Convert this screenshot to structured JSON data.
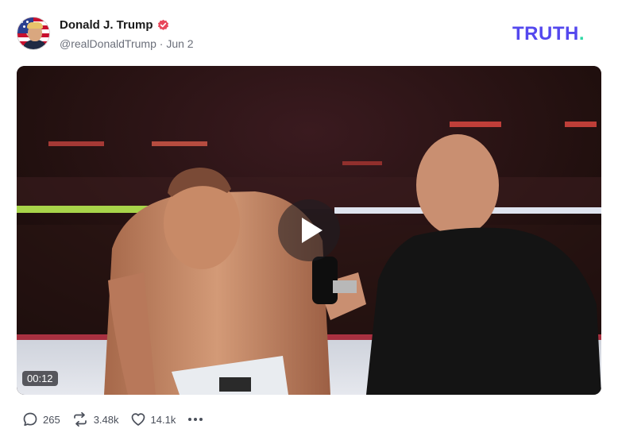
{
  "post": {
    "author": {
      "display_name": "Donald J. Trump",
      "handle": "@realDonaldTrump",
      "separator": "·",
      "date": "Jun 2",
      "verified": true,
      "avatar_icon": "avatar-flag-portrait"
    },
    "brand": {
      "logo_text": "TRUTH",
      "logo_dot": ".",
      "logo_color": "#5448ee",
      "dot_color": "#2fd8a6"
    },
    "video": {
      "duration": "00:12",
      "play_icon": "play-icon"
    },
    "actions": {
      "replies": "265",
      "retruths": "3.48k",
      "likes": "14.1k",
      "reply_icon": "comment-bubble-icon",
      "retruth_icon": "repost-arrows-icon",
      "like_icon": "heart-icon",
      "more_icon": "ellipsis-icon"
    }
  }
}
